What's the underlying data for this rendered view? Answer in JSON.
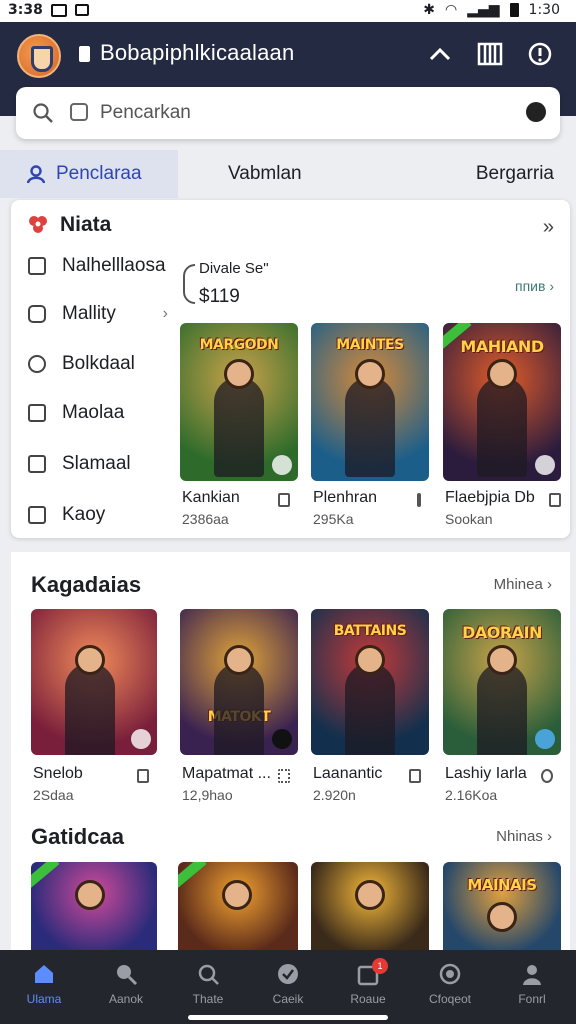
{
  "status": {
    "time_left": "3:38",
    "time_right": "1:30"
  },
  "header": {
    "title": "Bobapiphlkicaalaan"
  },
  "search": {
    "placeholder": "Pencarkan"
  },
  "tabs": [
    {
      "label": "Penclaraa"
    },
    {
      "label": "Vabmlan"
    },
    {
      "label": "Bergarria"
    }
  ],
  "panel": {
    "title": "Niata",
    "more": "»",
    "menu": [
      {
        "label": "Nalhelllaosa",
        "icon": "calendar-icon"
      },
      {
        "label": "Mallity",
        "icon": "square-icon",
        "chevron": "›"
      },
      {
        "label": "Bolkdaal",
        "icon": "pin-icon"
      },
      {
        "label": "Maolaa",
        "icon": "image-icon"
      },
      {
        "label": "Slamaal",
        "icon": "chat-icon"
      },
      {
        "label": "Kaoy",
        "icon": "card-icon"
      }
    ],
    "price_label": "Divale Se\"",
    "price_value": "$119",
    "price_more": "ппив ›",
    "games": [
      {
        "name": "Kankian",
        "sub": "2386aa",
        "art": "MARGODN",
        "colors": [
          "#2e6b2b",
          "#c9a24a"
        ]
      },
      {
        "name": "Plenhran",
        "sub": "295Ka",
        "art": "MAINTES",
        "colors": [
          "#1b5e8a",
          "#d68a3a"
        ]
      },
      {
        "name": "Flaebjpia Db",
        "sub": "Sookan",
        "art": "MAHIAND",
        "colors": [
          "#2b1c3d",
          "#e05b2a"
        ]
      }
    ]
  },
  "section1": {
    "title": "Kagadaias",
    "more": "Mhinea ›",
    "games": [
      {
        "name": "Snelob",
        "sub": "2Sdaa",
        "art": "",
        "colors": [
          "#7a1f3b",
          "#f08a5a"
        ]
      },
      {
        "name": "Mapatmat ...",
        "sub": "12,9hao",
        "art": "MATOKT",
        "colors": [
          "#3a2250",
          "#e0a33a"
        ]
      },
      {
        "name": "Laanantic",
        "sub": "2.920n",
        "art": "BATTAINS",
        "colors": [
          "#12304d",
          "#c23a3a"
        ]
      },
      {
        "name": "Lashiy Iarla",
        "sub": "2.16Koa",
        "art": "DAORAIN",
        "colors": [
          "#2a5e3a",
          "#c7a24a"
        ]
      }
    ]
  },
  "section2": {
    "title": "Gatidcaa",
    "more": "Nhinas ›",
    "games": [
      {
        "art": "",
        "colors": [
          "#2a2b7a",
          "#d04a9a"
        ]
      },
      {
        "art": "",
        "colors": [
          "#5a2a1a",
          "#f0a030"
        ]
      },
      {
        "art": "",
        "colors": [
          "#3a2a1a",
          "#f4b83a"
        ]
      },
      {
        "art": "MAINAIS",
        "colors": [
          "#24476a",
          "#e0a040"
        ]
      }
    ]
  },
  "nav": [
    {
      "label": "Ulama",
      "icon": "home-icon",
      "active": true
    },
    {
      "label": "Aanok",
      "icon": "search-icon"
    },
    {
      "label": "Thate",
      "icon": "search-icon"
    },
    {
      "label": "Caeik",
      "icon": "check-icon"
    },
    {
      "label": "Roaue",
      "icon": "bag-icon",
      "badge": "1"
    },
    {
      "label": "Cfoqeot",
      "icon": "game-icon"
    },
    {
      "label": "Fonrl",
      "icon": "profile-icon"
    }
  ]
}
